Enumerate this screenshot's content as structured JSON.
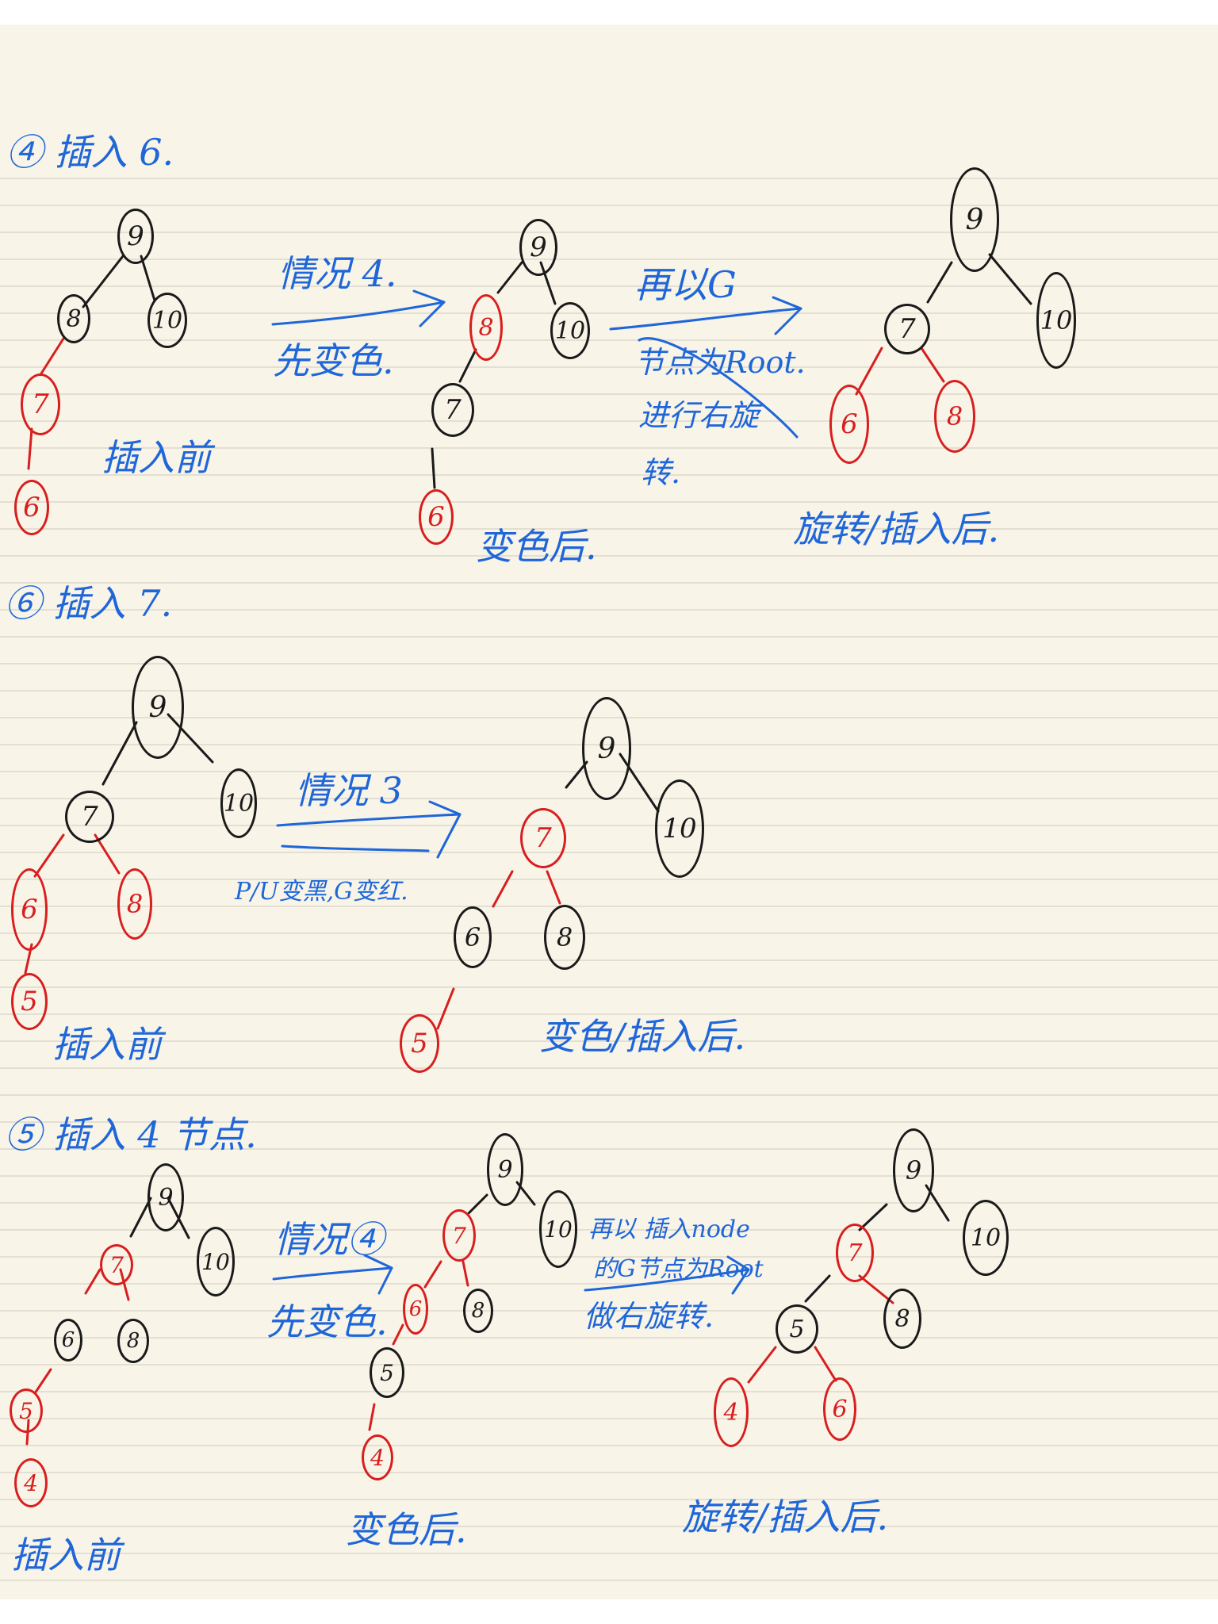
{
  "sections": {
    "s1": {
      "title": "④ 插入 6.",
      "tree_before": {
        "root": "9",
        "left": "8",
        "right": "10",
        "ll": "7",
        "lll": "6"
      },
      "label_before": "插入前",
      "step1": {
        "top": "情况 4.",
        "bottom": "先变色."
      },
      "tree_mid": {
        "root": "9",
        "left": "8",
        "right": "10",
        "ll": "7",
        "lll": "6"
      },
      "label_mid": "变色后.",
      "step2": {
        "top": "再以G",
        "line2": "节点为Root.",
        "line3": "进行右旋",
        "line4": "转."
      },
      "tree_after": {
        "root": "9",
        "left": "7",
        "right": "10",
        "ll": "6",
        "lr": "8"
      },
      "label_after": "旋转/插入后."
    },
    "s2": {
      "title": "⑥ 插入 7.",
      "tree_before": {
        "root": "9",
        "left": "7",
        "right": "10",
        "ll": "6",
        "lr": "8",
        "lll": "5"
      },
      "label_before": "插入前",
      "step1": {
        "top": "情况 3",
        "bottom": "P/U变黑,G变红."
      },
      "tree_after": {
        "root": "9",
        "left": "7",
        "right": "10",
        "ll": "6",
        "lr": "8",
        "lll": "5"
      },
      "label_after": "变色/插入后."
    },
    "s3": {
      "title": "⑤ 插入 4 节点.",
      "tree_before": {
        "root": "9",
        "left": "7",
        "right": "10",
        "ll": "6",
        "lr": "8",
        "lll": "5",
        "llll": "4"
      },
      "label_before": "插入前",
      "step1": {
        "top": "情况④",
        "bottom": "先变色."
      },
      "tree_mid": {
        "root": "9",
        "left": "7",
        "right": "10",
        "ll": "6",
        "lr": "8",
        "lll": "5",
        "llll": "4"
      },
      "label_mid": "变色后.",
      "step2": {
        "line1": "再以 插入node",
        "line2": "的G节点为Root",
        "line3": "做右旋转."
      },
      "tree_after": {
        "root": "9",
        "left": "7",
        "right": "10",
        "ll": "5",
        "lr": "8",
        "lll": "4",
        "llr": "6"
      },
      "label_after": "旋转/插入后."
    }
  },
  "colors": {
    "red": "#d81e1e",
    "black": "#1a1a1a",
    "blue": "#1f66d9",
    "paper": "#f8f4e8"
  }
}
